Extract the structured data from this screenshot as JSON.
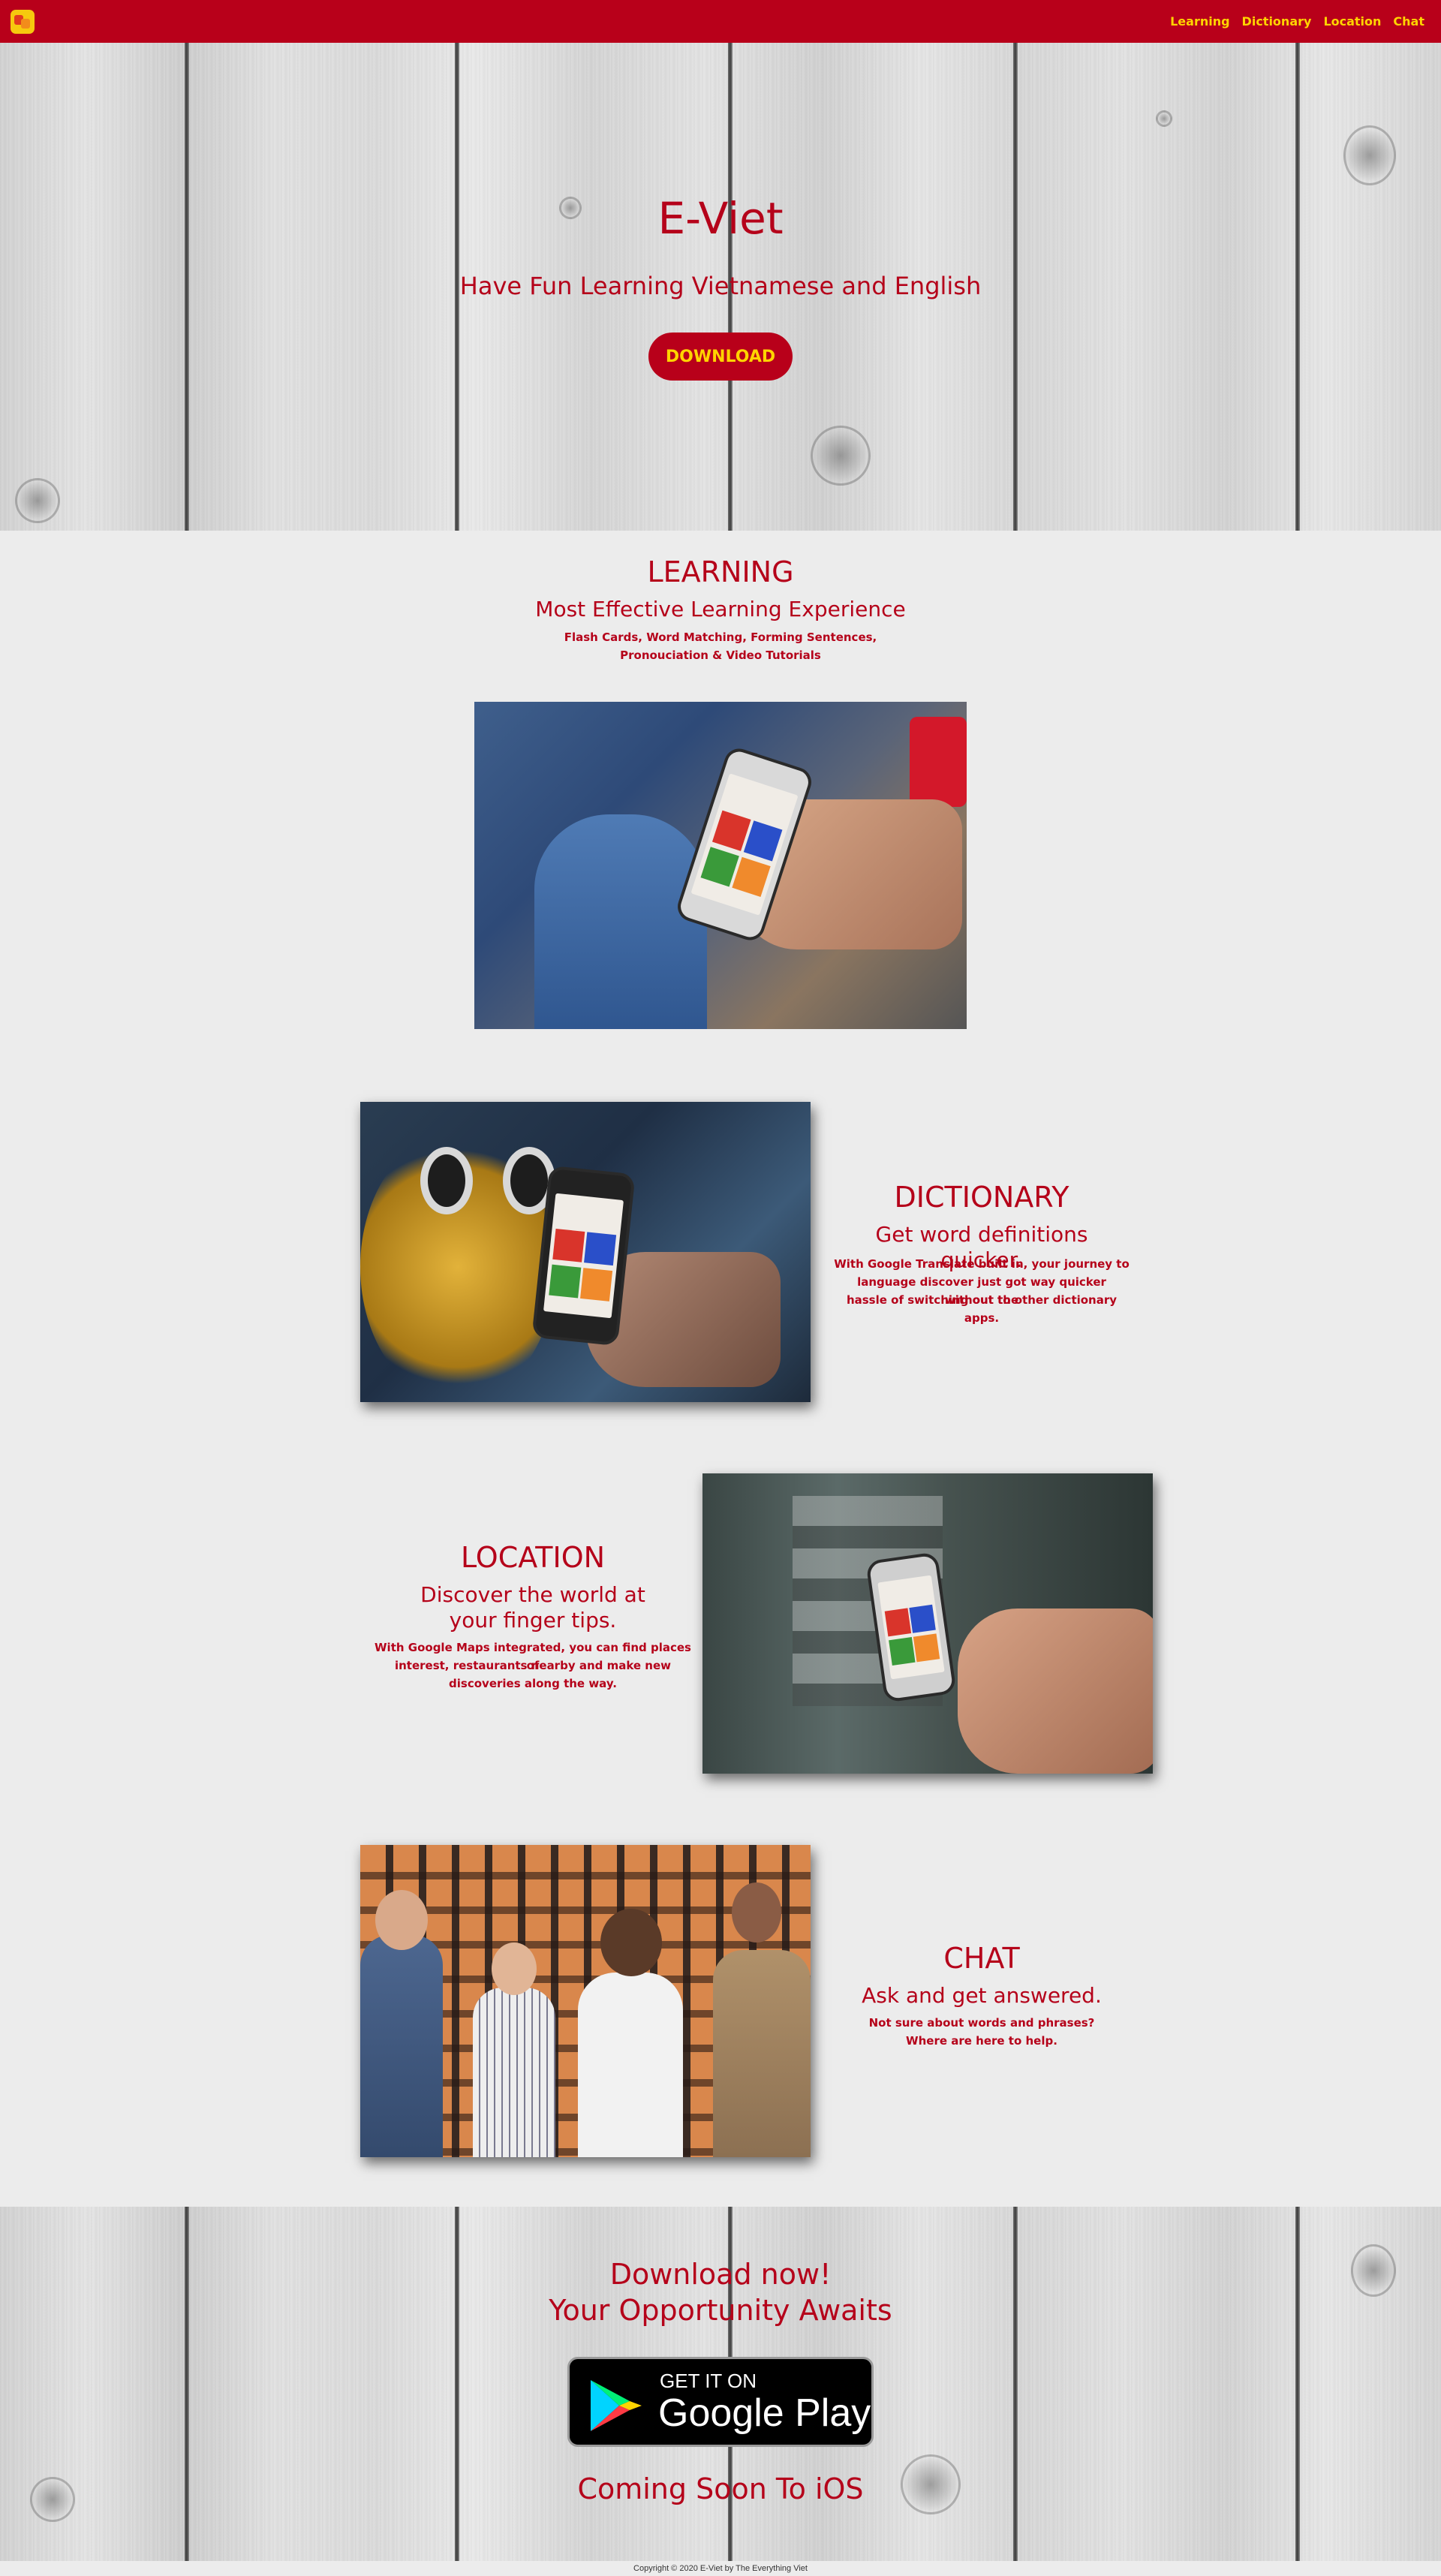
{
  "nav": {
    "links": [
      "Learning",
      "Dictionary",
      "Location",
      "Chat"
    ]
  },
  "hero": {
    "title": "E-Viet",
    "subtitle": "Have Fun Learning Vietnamese and English",
    "download_label": "DOWNLOAD"
  },
  "learning": {
    "title": "LEARNING",
    "subtitle": "Most Effective Learning Experience",
    "body_line1": "Flash Cards, Word Matching, Forming Sentences,",
    "body_line2": "Pronouciation & Video Tutorials"
  },
  "dictionary": {
    "title": "DICTIONARY",
    "subtitle": "Get word definitions quicker.",
    "body_line1": "With Google Translate built in, your journey to",
    "body_line2": "language discover just got way quicker without the",
    "body_line3": "hassle of switching out to other dictionary apps."
  },
  "location": {
    "title": "LOCATION",
    "subtitle_line1": "Discover the world at",
    "subtitle_line2": "your finger tips.",
    "body_line1": "With Google Maps integrated, you can find places of",
    "body_line2": "interest, restaurants nearby and make new",
    "body_line3": "discoveries along the way."
  },
  "chat": {
    "title": "CHAT",
    "subtitle": "Ask and get answered.",
    "body_line1": "Not sure about words and phrases?",
    "body_line2": "Where are here to help."
  },
  "download": {
    "line1": "Download now!",
    "line2": "Your Opportunity Awaits",
    "badge_small": "GET IT ON",
    "badge_big": "Google Play",
    "ios": "Coming Soon To iOS"
  },
  "footer": {
    "copyright": "Copyright © 2020 E-Viet by The Everything Viet"
  },
  "colors": {
    "brand_red": "#b8001a",
    "accent_yellow": "#ffd400",
    "page_bg": "#ececec"
  }
}
